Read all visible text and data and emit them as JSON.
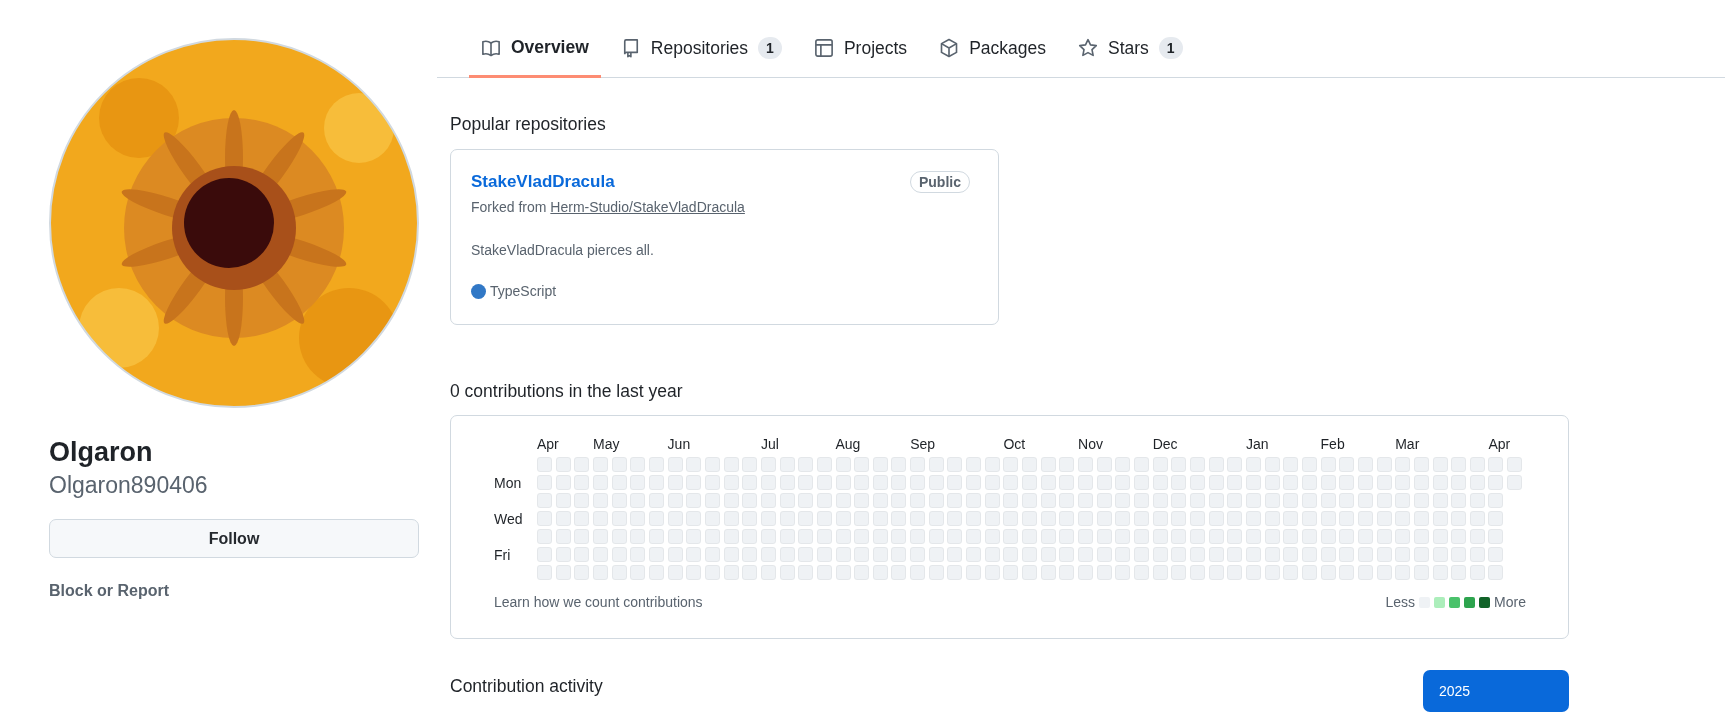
{
  "nav": {
    "tabs": [
      {
        "label": "Overview",
        "selected": true
      },
      {
        "label": "Repositories",
        "count": "1",
        "selected": false
      },
      {
        "label": "Projects",
        "selected": false
      },
      {
        "label": "Packages",
        "selected": false
      },
      {
        "label": "Stars",
        "count": "1",
        "selected": false
      }
    ]
  },
  "profile": {
    "name": "Olgaron",
    "username": "Olgaron890406",
    "follow_button": "Follow",
    "block_link": "Block or Report"
  },
  "popular": {
    "title": "Popular repositories",
    "repos": [
      {
        "name": "StakeVladDracula",
        "visibility": "Public",
        "fork_prefix": "Forked from",
        "fork_source": "Herm-Studio/StakeVladDracula",
        "description": "StakeVladDracula pierces all.",
        "language": {
          "name": "TypeScript",
          "color": "#3178c6"
        }
      }
    ]
  },
  "contributions": {
    "title": "0 contributions in the last year",
    "months": [
      "Apr",
      "May",
      "Jun",
      "Jul",
      "Aug",
      "Sep",
      "Oct",
      "Nov",
      "Dec",
      "Jan",
      "Feb",
      "Mar",
      "Apr"
    ],
    "day_labels": [
      "Mon",
      "Wed",
      "Fri"
    ],
    "learn_link": "Learn how we count contributions",
    "legend": {
      "less": "Less",
      "more": "More",
      "swatches": [
        {
          "color": "#eff2f5"
        },
        {
          "color": "#aceebb"
        },
        {
          "color": "#4ac26b"
        },
        {
          "color": "#2da44e"
        },
        {
          "color": "#116329"
        }
      ]
    }
  },
  "activity": {
    "title": "Contribution activity",
    "years": [
      {
        "label": "2025",
        "selected": true
      }
    ]
  }
}
